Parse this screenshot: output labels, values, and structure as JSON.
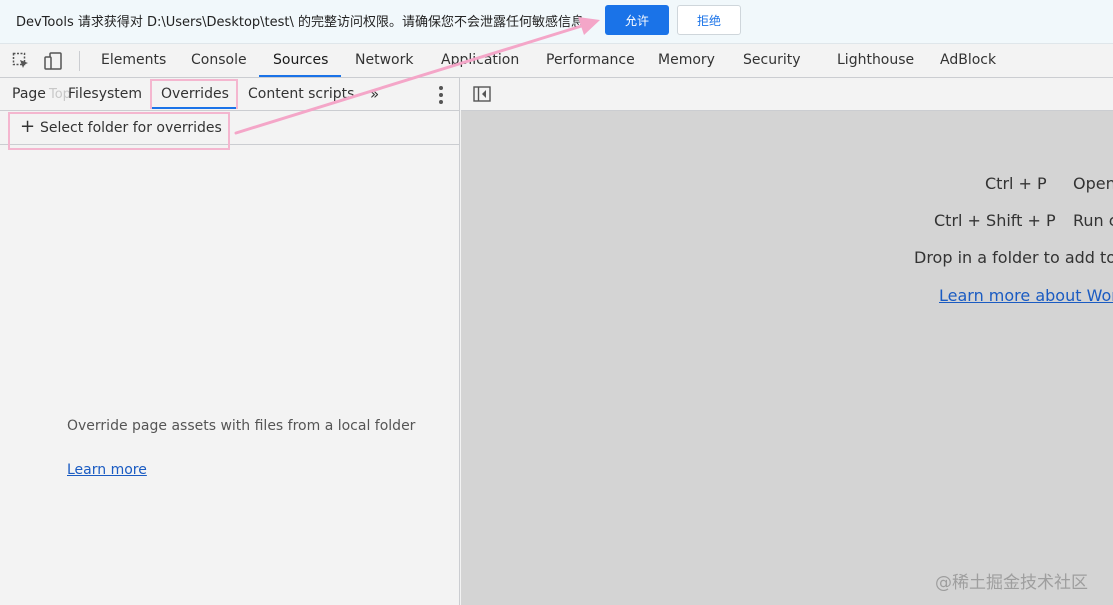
{
  "permission_bar": {
    "message": "DevTools 请求获得对 D:\\Users\\Desktop\\test\\ 的完整访问权限。请确保您不会泄露任何敏感信息。",
    "allow_label": "允许",
    "deny_label": "拒绝"
  },
  "main_tabs": [
    "Elements",
    "Console",
    "Sources",
    "Network",
    "Application",
    "Performance",
    "Memory",
    "Security",
    "Lighthouse",
    "AdBlock"
  ],
  "active_main_tab": "Sources",
  "sub_tabs": [
    "Page",
    "Filesystem",
    "Overrides",
    "Content scripts"
  ],
  "ghost_text": "Top",
  "more_tabs": "»",
  "select_folder_label": "Select folder for overrides",
  "empty_message": "Override page assets with files from a local folder",
  "learn_more": "Learn more",
  "right": {
    "shortcut1_keys": "Ctrl + P",
    "shortcut1_desc": "Open",
    "shortcut2_keys": "Ctrl + Shift + P",
    "shortcut2_desc": "Run c",
    "drop_text": "Drop in a folder to add to",
    "link_text": "Learn more about Wor"
  },
  "watermark": "@稀土掘金技术社区",
  "colors": {
    "accent": "#1a73e8",
    "highlight": "#f4b6cf",
    "arrow": "#f4a6c8"
  }
}
